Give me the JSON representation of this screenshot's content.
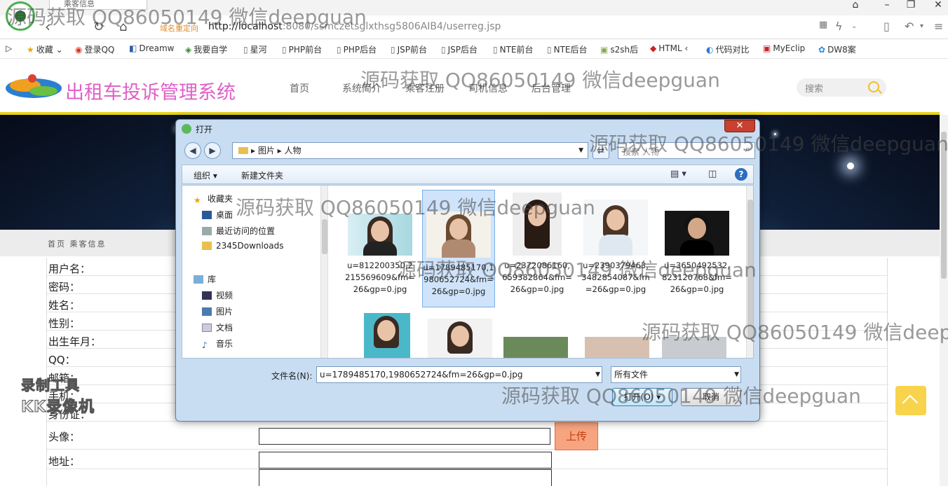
{
  "browser": {
    "tab_title": "乘客信息",
    "redirect_label": "域名重定向",
    "url_host": "http://localhost",
    "url_rest": ":8080/ssmczetsglxthsg5806AIB4/userreg.jsp",
    "bookmarks": [
      "收藏",
      "登录QQ",
      "Dreamw",
      "我要自学",
      "星河",
      "PHP前台",
      "PHP后台",
      "JSP前台",
      "JSP后台",
      "NTE前台",
      "NTE后台",
      "s2sh后",
      "HTML",
      "代码对比",
      "MyEclip",
      "DW8案"
    ]
  },
  "site": {
    "title": "出租车投诉管理系统",
    "nav": [
      "首页",
      "系统简介",
      "乘客注册",
      "司机信息",
      "后台管理"
    ],
    "search_placeholder": "搜索",
    "breadcrumb": "首页 乘客信息"
  },
  "form": {
    "labels": [
      "用户名：",
      "密码：",
      "姓名：",
      "性别：",
      "出生年月：",
      "QQ：",
      "邮箱：",
      "手机：",
      "身份证：",
      "头像：",
      "地址："
    ],
    "upload_label": "上传"
  },
  "dialog": {
    "title": "打开",
    "path": [
      "图片",
      "人物"
    ],
    "search_placeholder": "搜索 人物",
    "organize": "组织",
    "new_folder": "新建文件夹",
    "tree": {
      "favorites": "收藏夹",
      "desktop": "桌面",
      "recent": "最近访问的位置",
      "downloads": "2345Downloads",
      "libraries": "库",
      "videos": "视频",
      "pictures": "图片",
      "documents": "文档",
      "music": "音乐"
    },
    "files": [
      {
        "name": "u=812200350,2215569609&fm=26&gp=0.jpg"
      },
      {
        "name": "u=1789485170,1980652724&fm=26&gp=0.jpg"
      },
      {
        "name": "u=2372086160,659382864&fm=26&gp=0.jpg"
      },
      {
        "name": "u=2390379463,3482854087&fm=26&gp=0.jpg"
      },
      {
        "name": "u=3650492532,823120768&fm=26&gp=0.jpg"
      }
    ],
    "filename_label": "文件名(N):",
    "filename_value": "u=1789485170,1980652724&fm=26&gp=0.jpg",
    "filter_value": "所有文件",
    "open_button": "打开(O)",
    "cancel_button": "取消"
  },
  "overlays": {
    "watermark": "源码获取 QQ86050149 微信deepguan",
    "recorder_line1": "录制工具",
    "recorder_line2": "KK录像机"
  },
  "colors": {
    "site_title": "#e060c8",
    "header_rule": "#e8d21c",
    "upload_button": "#f7a480",
    "back_to_top": "#f8d44c"
  }
}
